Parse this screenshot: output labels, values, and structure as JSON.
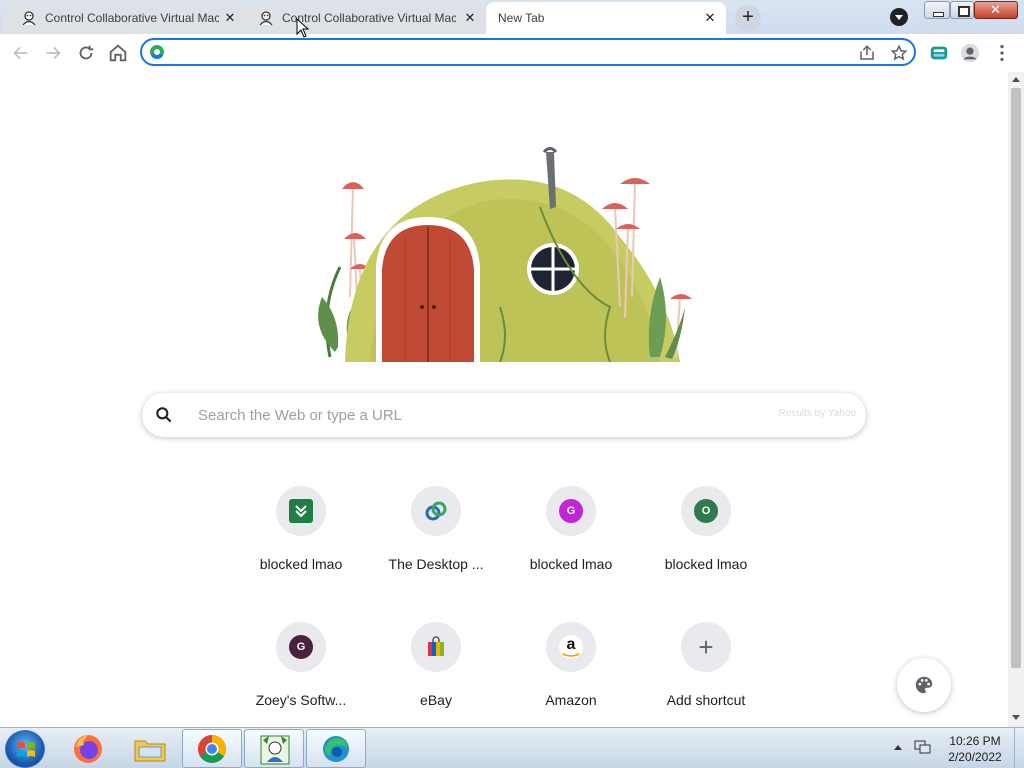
{
  "browser": {
    "tabs": [
      {
        "title": "Control Collaborative Virtual Mac",
        "state": "inactive"
      },
      {
        "title": "Control Collaborative Virtual Mac",
        "state": "inactive"
      },
      {
        "title": "New Tab",
        "state": "active"
      }
    ],
    "omnibox": {
      "value": "",
      "placeholder": ""
    }
  },
  "new_tab_page": {
    "search": {
      "placeholder": "Search the Web or type a URL",
      "results_by": "Results by Yahoo"
    },
    "shortcuts": [
      {
        "label": "blocked lmao",
        "icon": "green-square-icon",
        "letter": "",
        "color": "#1e7e46"
      },
      {
        "label": "The Desktop ...",
        "icon": "desktop-link-icon",
        "letter": "",
        "color": "#2b6cb0"
      },
      {
        "label": "blocked lmao",
        "icon": "letter-g-icon",
        "letter": "G",
        "color": "#c026d3"
      },
      {
        "label": "blocked lmao",
        "icon": "letter-o-icon",
        "letter": "O",
        "color": "#2f7a4f"
      },
      {
        "label": "Zoey's Softw...",
        "icon": "letter-g-icon",
        "letter": "G",
        "color": "#4a2140"
      },
      {
        "label": "eBay",
        "icon": "shopping-bag-icon",
        "letter": "",
        "color": "#e53238"
      },
      {
        "label": "Amazon",
        "icon": "amazon-icon",
        "letter": "a",
        "color": "#ffffff"
      },
      {
        "label": "Add shortcut",
        "icon": "plus-icon",
        "letter": "+",
        "color": "#5f6368"
      }
    ]
  },
  "taskbar": {
    "time": "10:26 PM",
    "date": "2/20/2022"
  }
}
